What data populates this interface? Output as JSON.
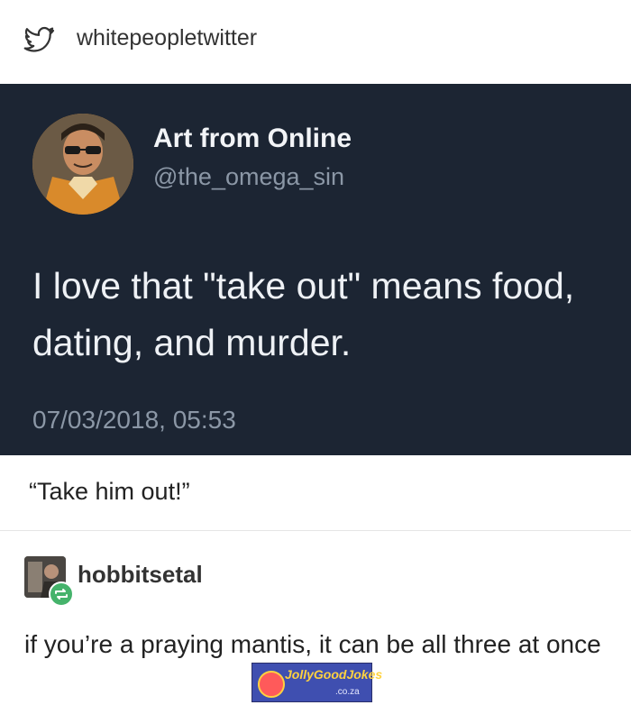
{
  "header": {
    "icon": "twitter-bird-icon",
    "blog_name": "whitepeopletwitter"
  },
  "tweet": {
    "author_name": "Art from Online",
    "author_handle": "@the_omega_sin",
    "text": "I love that \"take out\" means food, dating, and murder.",
    "timestamp": "07/03/2018, 05:53",
    "colors": {
      "background": "#1c2533",
      "text": "#eef1f5",
      "muted": "#8b97a6"
    }
  },
  "reply_1": {
    "text": "“Take him out!”"
  },
  "reply_2": {
    "username": "hobbitsetal",
    "badge_icon": "reblog-icon",
    "text": "if you’re a praying mantis, it can be all three at once"
  },
  "watermark": {
    "brand": "JollyGoodJokes",
    "domain": ".co.za"
  }
}
